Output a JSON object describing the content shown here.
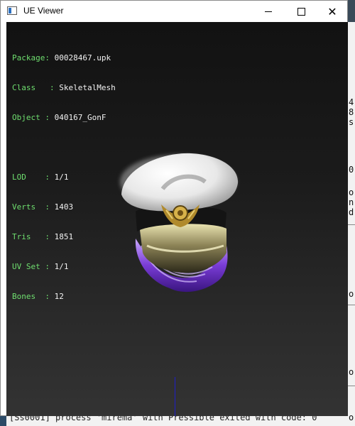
{
  "window": {
    "title": "UE Viewer",
    "controls": {
      "minimize": "minimize",
      "maximize": "maximize",
      "close": "✕"
    }
  },
  "info": {
    "package_label": "Package",
    "package_value": "00028467.upk",
    "class_label": "Class",
    "class_value": "SkeletalMesh",
    "object_label": "Object",
    "object_value": "040167_GonF",
    "lod_label": "LOD",
    "lod_value": "1/1",
    "verts_label": "Verts",
    "verts_value": "1403",
    "tris_label": "Tris",
    "tris_value": "1851",
    "uvset_label": "UV Set",
    "uvset_value": "1/1",
    "bones_label": "Bones",
    "bones_value": "12"
  },
  "background_console": {
    "bottom_line": "[Ss0001] process 'mirema' with Pressible exited with code: 0",
    "right_fragments": [
      "4",
      "8",
      "s",
      "0",
      "o",
      "n",
      "d",
      "o",
      "o",
      "o"
    ]
  },
  "colors": {
    "label": "#6fdf6f",
    "value": "#f2f2f2",
    "axis": "#1e1ec8"
  }
}
